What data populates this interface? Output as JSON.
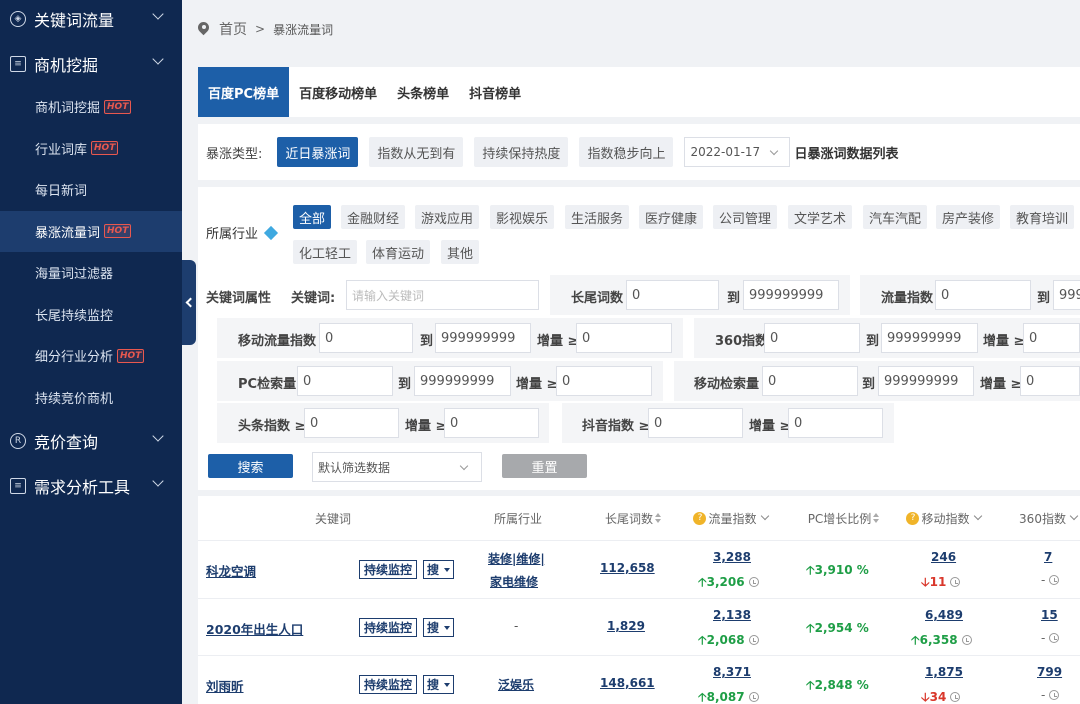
{
  "sidebar": {
    "groups": [
      {
        "label": "关键词流量",
        "icon": "compass-icon"
      },
      {
        "label": "商机挖掘",
        "icon": "document-search-icon"
      },
      {
        "label": "竞价查询",
        "icon": "registered-icon"
      },
      {
        "label": "需求分析工具",
        "icon": "list-doc-icon"
      }
    ],
    "items": [
      {
        "label": "商机词挖掘",
        "hot": "HOT"
      },
      {
        "label": "行业词库",
        "hot": "HOT"
      },
      {
        "label": "每日新词",
        "hot": ""
      },
      {
        "label": "暴涨流量词",
        "hot": "HOT"
      },
      {
        "label": "海量词过滤器",
        "hot": ""
      },
      {
        "label": "长尾持续监控",
        "hot": ""
      },
      {
        "label": "细分行业分析",
        "hot": "HOT"
      },
      {
        "label": "持续竞价商机",
        "hot": ""
      }
    ]
  },
  "breadcrumb": {
    "home": "首页",
    "sep": ">",
    "current": "暴涨流量词"
  },
  "tabs": [
    "百度PC榜单",
    "百度移动榜单",
    "头条榜单",
    "抖音榜单"
  ],
  "surge": {
    "label": "暴涨类型:",
    "types": [
      "近日暴涨词",
      "指数从无到有",
      "持续保持热度",
      "指数稳步向上"
    ],
    "date": "2022-01-17",
    "date_suffix": "日暴涨词数据列表"
  },
  "industry": {
    "label": "所属行业",
    "chips": [
      "全部",
      "金融财经",
      "游戏应用",
      "影视娱乐",
      "生活服务",
      "医疗健康",
      "公司管理",
      "文学艺术",
      "汽车汽配",
      "房产装修",
      "教育培训",
      "化工轻工",
      "体育运动",
      "其他"
    ]
  },
  "attrs": {
    "section_label": "关键词属性",
    "keyword_label": "关键词:",
    "keyword_placeholder": "请输入关键词",
    "longtail_label": "长尾词数",
    "flow_label": "流量指数",
    "mobile_flow_label": "移动流量指数",
    "idx360_label": "360指数",
    "pc_search_label": "PC检索量",
    "mobile_search_label": "移动检索量",
    "toutiao_label": "头条指数 ≥",
    "douyin_label": "抖音指数 ≥",
    "to_label": "到",
    "inc_label": "增量 ≥",
    "min": "0",
    "max": "999999999",
    "max_cut": "999"
  },
  "actions": {
    "search": "搜索",
    "preset": "默认筛选数据",
    "reset": "重置"
  },
  "table": {
    "headers": {
      "keyword": "关键词",
      "industry": "所属行业",
      "longtail": "长尾词数",
      "flow": "流量指数",
      "pc_growth": "PC增长比例",
      "mobile": "移动指数",
      "idx360": "360指数"
    },
    "monitor_label": "持续监控",
    "search_label": "搜",
    "rows": [
      {
        "keyword": "科龙空调",
        "industry1": "装修|维修|",
        "industry2": "家电维修",
        "longtail": "112,658",
        "flow": "3,288",
        "flow_delta": "3,206",
        "flow_dir": "up",
        "pc_growth": "3,910 %",
        "mobile": "246",
        "mobile_delta": "11",
        "mobile_dir": "down",
        "idx360": "7",
        "idx360_delta": "-"
      },
      {
        "keyword": "2020年出生人口",
        "industry1": "-",
        "industry2": "",
        "longtail": "1,829",
        "flow": "2,138",
        "flow_delta": "2,068",
        "flow_dir": "up",
        "pc_growth": "2,954 %",
        "mobile": "6,489",
        "mobile_delta": "6,358",
        "mobile_dir": "up",
        "idx360": "15",
        "idx360_delta": "-"
      },
      {
        "keyword": "刘雨昕",
        "industry1": "泛娱乐",
        "industry2": "",
        "longtail": "148,661",
        "flow": "8,371",
        "flow_delta": "8,087",
        "flow_dir": "up",
        "pc_growth": "2,848 %",
        "mobile": "1,875",
        "mobile_delta": "34",
        "mobile_dir": "down",
        "idx360": "799",
        "idx360_delta": "-"
      }
    ]
  },
  "colors": {
    "sidebar_bg": "#0f2850",
    "accent": "#1d5fa8",
    "up": "#1e9e46",
    "down": "#d9372b",
    "hot": "#e8584f"
  }
}
